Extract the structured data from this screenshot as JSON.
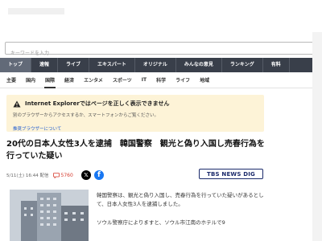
{
  "search": {
    "placeholder": "キーワードを入力"
  },
  "nav": {
    "items": [
      "トップ",
      "速報",
      "ライブ",
      "エキスパート",
      "オリジナル",
      "みんなの意見",
      "ランキング",
      "有料"
    ],
    "active_index": 0
  },
  "subnav": {
    "items": [
      "主要",
      "国内",
      "国際",
      "経済",
      "エンタメ",
      "スポーツ",
      "IT",
      "科学",
      "ライフ",
      "地域"
    ],
    "active_index": 2
  },
  "notice": {
    "title": "Internet Explorerではページを正しく表示できません",
    "text": "別のブラウザーからアクセスするか、スマートフォンからご覧ください。",
    "link": "推奨ブラウザーについて"
  },
  "article": {
    "headline": "20代の日本人女性3人を逮捕　韓国警察　観光と偽り入国し売春行為を行っていた疑い",
    "date": "5/11(土) 16:44 配信",
    "comment_count": "5760",
    "source_logo": "TBS NEWS DIG",
    "paragraphs": [
      "韓国警察は、観光と偽り入国し、売春行為を行っていた疑いがあるとして、日本人女性3人を逮捕しました。",
      "ソウル警察庁によりますと、ソウル市江南のホテルで9"
    ]
  },
  "colors": {
    "nav_bg": "#393f4a",
    "notice_bg": "#fdf3d7",
    "comment_red": "#d63b2e",
    "facebook_blue": "#1877f2",
    "tbs_navy": "#1b2a6b"
  }
}
